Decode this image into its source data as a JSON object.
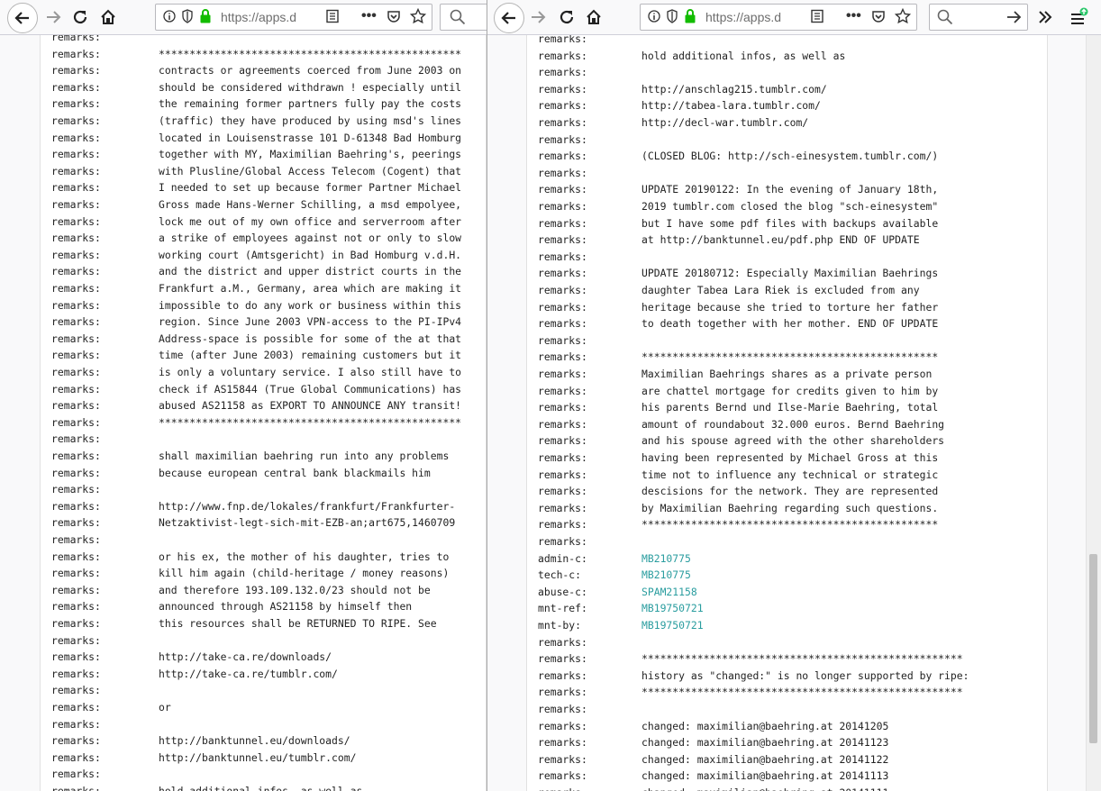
{
  "left_window": {
    "url": "https://apps.d",
    "lines": [
      [
        "remarks:",
        ""
      ],
      [
        "remarks:",
        "*************************************************"
      ],
      [
        "remarks:",
        "contracts or agreements coerced from June 2003 on"
      ],
      [
        "remarks:",
        "should be considered withdrawn ! especially until"
      ],
      [
        "remarks:",
        "the remaining former partners fully pay the costs"
      ],
      [
        "remarks:",
        "(traffic) they have produced by using msd's lines"
      ],
      [
        "remarks:",
        "located in Louisenstrasse 101 D-61348 Bad Homburg"
      ],
      [
        "remarks:",
        "together with MY, Maximilian Baehring's, peerings"
      ],
      [
        "remarks:",
        "with Plusline/Global Access Telecom (Cogent) that"
      ],
      [
        "remarks:",
        "I needed to set up because former Partner Michael"
      ],
      [
        "remarks:",
        "Gross made Hans-Werner Schilling, a msd empolyee,"
      ],
      [
        "remarks:",
        "lock me out of my own office and serverroom after"
      ],
      [
        "remarks:",
        "a strike of employees against not or only to slow"
      ],
      [
        "remarks:",
        "working court (Amtsgericht) in Bad Homburg v.d.H."
      ],
      [
        "remarks:",
        "and the district and upper district courts in the"
      ],
      [
        "remarks:",
        "Frankfurt a.M., Germany, area which are making it"
      ],
      [
        "remarks:",
        "impossible to do any work or business within this"
      ],
      [
        "remarks:",
        "region. Since June 2003 VPN-access to the PI-IPv4"
      ],
      [
        "remarks:",
        "Address-space is possible for some of the at that"
      ],
      [
        "remarks:",
        "time (after June 2003) remaining customers but it"
      ],
      [
        "remarks:",
        "is only a voluntary service. I also still have to"
      ],
      [
        "remarks:",
        "check if AS15844 (True Global Communications) has"
      ],
      [
        "remarks:",
        "abused AS21158 as EXPORT TO ANNOUNCE ANY transit!"
      ],
      [
        "remarks:",
        "*************************************************"
      ],
      [
        "remarks:",
        ""
      ],
      [
        "remarks:",
        "shall maximilian baehring run into any problems"
      ],
      [
        "remarks:",
        "because european central bank blackmails him"
      ],
      [
        "remarks:",
        ""
      ],
      [
        "remarks:",
        "http://www.fnp.de/lokales/frankfurt/Frankfurter-"
      ],
      [
        "remarks:",
        "Netzaktivist-legt-sich-mit-EZB-an;art675,1460709"
      ],
      [
        "remarks:",
        ""
      ],
      [
        "remarks:",
        "or his ex, the mother of his daughter, tries to"
      ],
      [
        "remarks:",
        "kill him again (child-heritage / money reasons)"
      ],
      [
        "remarks:",
        "and therefore 193.109.132.0/23 should not be"
      ],
      [
        "remarks:",
        "announced through AS21158 by himself then"
      ],
      [
        "remarks:",
        "this resources shall be RETURNED TO RIPE. See"
      ],
      [
        "remarks:",
        ""
      ],
      [
        "remarks:",
        "http://take-ca.re/downloads/"
      ],
      [
        "remarks:",
        "http://take-ca.re/tumblr.com/"
      ],
      [
        "remarks:",
        ""
      ],
      [
        "remarks:",
        "or"
      ],
      [
        "remarks:",
        ""
      ],
      [
        "remarks:",
        "http://banktunnel.eu/downloads/"
      ],
      [
        "remarks:",
        "http://banktunnel.eu/tumblr.com/"
      ],
      [
        "remarks:",
        ""
      ],
      [
        "remarks:",
        "hold additional infos, as well as"
      ]
    ]
  },
  "right_window": {
    "url": "https://apps.d",
    "lines": [
      [
        "remarks:",
        ""
      ],
      [
        "remarks:",
        "hold additional infos, as well as"
      ],
      [
        "remarks:",
        ""
      ],
      [
        "remarks:",
        "http://anschlag215.tumblr.com/"
      ],
      [
        "remarks:",
        "http://tabea-lara.tumblr.com/"
      ],
      [
        "remarks:",
        "http://decl-war.tumblr.com/"
      ],
      [
        "remarks:",
        ""
      ],
      [
        "remarks:",
        "(CLOSED BLOG: http://sch-einesystem.tumblr.com/)"
      ],
      [
        "remarks:",
        ""
      ],
      [
        "remarks:",
        "UPDATE 20190122: In the evening of January 18th,"
      ],
      [
        "remarks:",
        "2019 tumblr.com closed the blog \"sch-einesystem\""
      ],
      [
        "remarks:",
        "but I have some pdf files with backups available"
      ],
      [
        "remarks:",
        "at http://banktunnel.eu/pdf.php END OF UPDATE"
      ],
      [
        "remarks:",
        ""
      ],
      [
        "remarks:",
        "UPDATE 20180712: Especially Maximilian Baehrings"
      ],
      [
        "remarks:",
        "daughter Tabea Lara Riek is excluded from any"
      ],
      [
        "remarks:",
        "heritage because she tried to torture her father"
      ],
      [
        "remarks:",
        "to death together with her mother. END OF UPDATE"
      ],
      [
        "remarks:",
        ""
      ],
      [
        "remarks:",
        "************************************************"
      ],
      [
        "remarks:",
        "Maximilian Baehrings shares as a private person"
      ],
      [
        "remarks:",
        "are chattel mortgage for credits given to him by"
      ],
      [
        "remarks:",
        "his parents Bernd und Ilse-Marie Baehring, total"
      ],
      [
        "remarks:",
        "amount of roundabout 32.000 euros. Bernd Baehring"
      ],
      [
        "remarks:",
        "and his spouse agreed with the other shareholders"
      ],
      [
        "remarks:",
        "having been represented by Michael Gross at this"
      ],
      [
        "remarks:",
        "time not to influence any technical or strategic"
      ],
      [
        "remarks:",
        "descisions for the network. They are represented"
      ],
      [
        "remarks:",
        "by Maximilian Baehring regarding such questions."
      ],
      [
        "remarks:",
        "************************************************"
      ],
      [
        "remarks:",
        ""
      ],
      [
        "admin-c:",
        "MB210775",
        true
      ],
      [
        "tech-c:",
        "MB210775",
        true
      ],
      [
        "abuse-c:",
        "SPAM21158",
        true
      ],
      [
        "mnt-ref:",
        "MB19750721",
        true
      ],
      [
        "mnt-by:",
        "MB19750721",
        true
      ],
      [
        "remarks:",
        ""
      ],
      [
        "remarks:",
        "****************************************************"
      ],
      [
        "remarks:",
        "history as \"changed:\" is no longer supported by ripe:"
      ],
      [
        "remarks:",
        "****************************************************"
      ],
      [
        "remarks:",
        ""
      ],
      [
        "remarks:",
        "changed: maximilian@baehring.at 20141205"
      ],
      [
        "remarks:",
        "changed: maximilian@baehring.at 20141123"
      ],
      [
        "remarks:",
        "changed: maximilian@baehring.at 20141122"
      ],
      [
        "remarks:",
        "changed: maximilian@baehring.at 20141113"
      ],
      [
        "remarks:",
        "changed: maximilian@baehring.at 20141111"
      ]
    ]
  }
}
